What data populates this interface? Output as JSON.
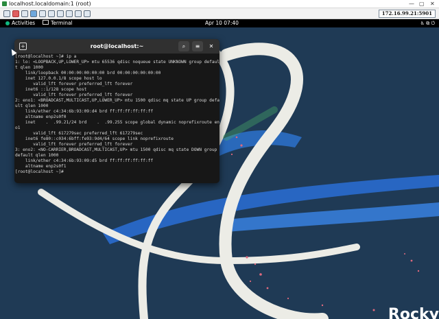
{
  "vnc": {
    "title": "localhost.localdomain:1 (root)",
    "address": "172.16.99.21:5901"
  },
  "topbar": {
    "activities": "Activities",
    "app": "Terminal",
    "datetime": "Apr 10  07:40"
  },
  "terminal": {
    "title": "root@localhost:~",
    "lines": [
      "[root@localhost ~]# ip a",
      "1: lo: <LOOPBACK,UP,LOWER_UP> mtu 65536 qdisc noqueue state UNKNOWN group defaul",
      "t qlen 1000",
      "    link/loopback 00:00:00:00:00:00 brd 00:00:00:00:00:00",
      "    inet 127.0.0.1/8 scope host lo",
      "       valid_lft forever preferred_lft forever",
      "    inet6 ::1/128 scope host",
      "       valid_lft forever preferred_lft forever",
      "2: eno1: <BROADCAST,MULTICAST,UP,LOWER_UP> mtu 1500 qdisc mq state UP group defa",
      "ult qlen 1000",
      "    link/ether c4:34:6b:93:09:d4 brd ff:ff:ff:ff:ff:ff",
      "    altname enp2s0f0",
      "    inet    .  .99.21/24 brd    .  .99.255 scope global dynamic noprefixroute en",
      "o1",
      "       valid_lft 617279sec preferred_lft 617279sec",
      "    inet6 fe80::c034:6bff:fe93:9d4/64 scope link noprefixroute",
      "       valid_lft forever preferred_lft forever",
      "3: eno2: <NO-CARRIER,BROADCAST,MULTICAST,UP> mtu 1500 qdisc mq state DOWN group",
      "default qlen 1000",
      "    link/ether c4:34:6b:93:09:d5 brd ff:ff:ff:ff:ff:ff",
      "    altname enp2s0f1",
      "[root@localhost ~]# "
    ]
  },
  "desktop": {
    "brand": "Rocky"
  },
  "colors": {
    "wallpaper": "#1f3a55",
    "terminal_bg": "#171717",
    "headerbar": "#303030",
    "ribbon_blue": "#2a6fd6",
    "accent_green": "#10b981",
    "dots_pink": "#e06a7e"
  },
  "icons": [
    "terminal-new-tab-icon",
    "search-icon",
    "menu-icon",
    "close-icon",
    "network-icon",
    "power-icon",
    "accessibility-icon"
  ]
}
